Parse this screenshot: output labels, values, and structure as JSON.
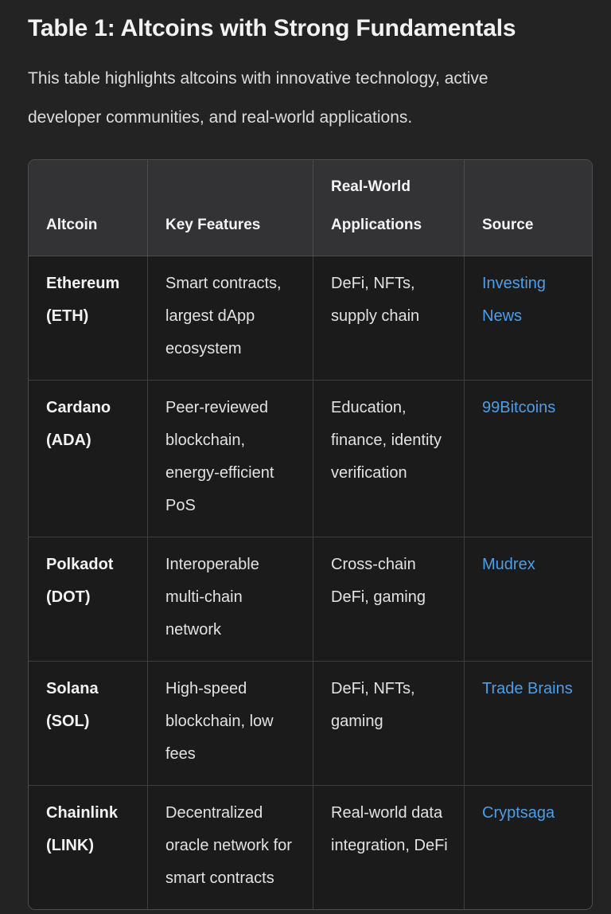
{
  "document": {
    "title": "Table 1: Altcoins with Strong Fundamentals",
    "intro": "This table highlights altcoins with innovative technology, active developer communities, and real-world applications."
  },
  "colors": {
    "page_background": "#232323",
    "header_background": "#333336",
    "cell_background": "#1b1b1b",
    "border": "#4d4d4d",
    "text": "#e2e2e2",
    "link": "#4f9de6"
  },
  "table": {
    "columns": [
      {
        "key": "altcoin",
        "label": "Altcoin"
      },
      {
        "key": "features",
        "label": "Key Features"
      },
      {
        "key": "apps",
        "label": "Real-World Applications"
      },
      {
        "key": "source",
        "label": "Source"
      }
    ],
    "rows": [
      {
        "altcoin": "Ethereum (ETH)",
        "features": "Smart contracts, largest dApp ecosystem",
        "apps": "DeFi, NFTs, supply chain",
        "source": "Investing News"
      },
      {
        "altcoin": "Cardano (ADA)",
        "features": "Peer-reviewed blockchain, energy-efficient PoS",
        "apps": "Education, finance, identity verification",
        "source": "99Bitcoins"
      },
      {
        "altcoin": "Polkadot (DOT)",
        "features": "Interoperable multi-chain network",
        "apps": "Cross-chain DeFi, gaming",
        "source": "Mudrex"
      },
      {
        "altcoin": "Solana (SOL)",
        "features": "High-speed blockchain, low fees",
        "apps": "DeFi, NFTs, gaming",
        "source": "Trade Brains"
      },
      {
        "altcoin": "Chainlink (LINK)",
        "features": "Decentralized oracle network for smart contracts",
        "apps": "Real-world data integration, DeFi",
        "source": "Cryptsaga"
      }
    ]
  }
}
